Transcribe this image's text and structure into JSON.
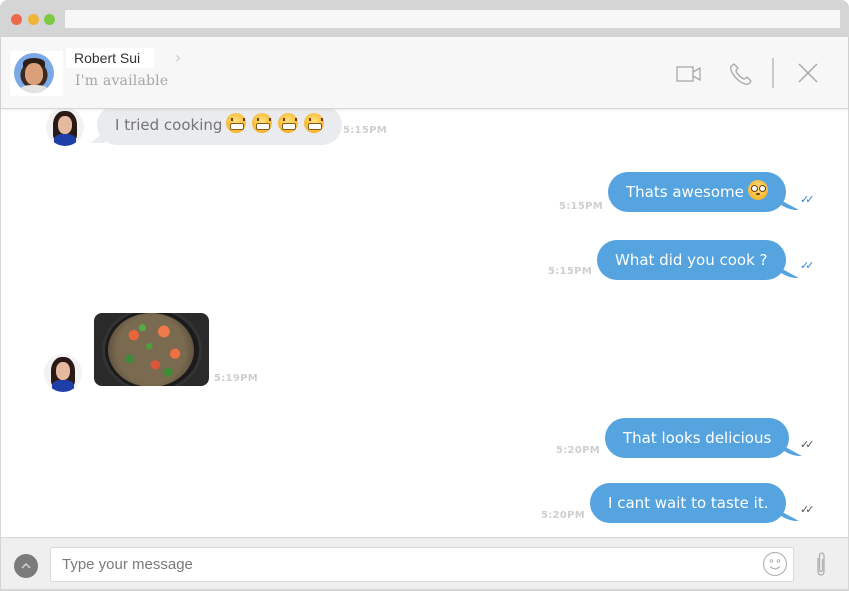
{
  "window": {
    "traffic_lights": [
      "close",
      "minimize",
      "maximize"
    ],
    "url": ""
  },
  "header": {
    "contact_name": "Robert Sui",
    "contact_status": "I'm available",
    "chevron": "›",
    "actions": [
      {
        "name": "video-call",
        "icon": "video-camera-icon"
      },
      {
        "name": "voice-call",
        "icon": "phone-icon"
      },
      {
        "name": "close-chat",
        "icon": "close-icon"
      }
    ]
  },
  "messages": [
    {
      "direction": "incoming",
      "type": "text",
      "text": "I tried cooking",
      "emoji": [
        "grimacing-face",
        "grimacing-face",
        "grimacing-face",
        "grimacing-face"
      ],
      "time": "5:15PM"
    },
    {
      "direction": "outgoing",
      "type": "text",
      "text": "Thats awesome",
      "emoji": [
        "flushed-face"
      ],
      "time": "5:15PM",
      "status": "read"
    },
    {
      "direction": "outgoing",
      "type": "text",
      "text": "What did you cook ?",
      "time": "5:15PM",
      "status": "read"
    },
    {
      "direction": "incoming",
      "type": "image",
      "image_alt": "seafood paella in a pan",
      "time": "5:19PM"
    },
    {
      "direction": "outgoing",
      "type": "text",
      "text": "That looks delicious",
      "time": "5:20PM",
      "status": "delivered"
    },
    {
      "direction": "outgoing",
      "type": "text",
      "text": "I cant wait to taste it.",
      "time": "5:20PM",
      "status": "delivered"
    }
  ],
  "check_glyph": "✓✓",
  "composer": {
    "placeholder": "Type your message",
    "value": ""
  },
  "colors": {
    "outgoing_bubble": "#55a4e0",
    "incoming_bubble": "#e9ebee",
    "read_check": "#2f86cf",
    "delivered_check": "#555555"
  }
}
